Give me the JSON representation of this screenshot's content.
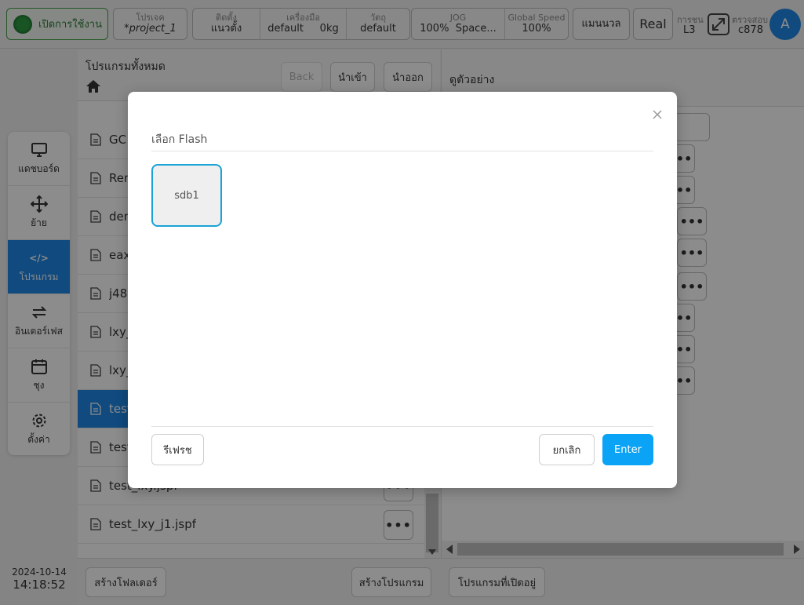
{
  "topbar": {
    "power_label": "เปิดการใช้งาน",
    "project": {
      "label": "โปรเจค",
      "value": "*project_1"
    },
    "install": {
      "label": "ติดตั้ง",
      "value": "แนวตั้ง"
    },
    "tool": {
      "label": "เครื่องมือ",
      "value": "default",
      "payload": "0kg"
    },
    "object": {
      "label": "วัตถุ",
      "value": "default"
    },
    "jog": {
      "label": "JOG",
      "value_pct": "100%",
      "value_space": "Space..."
    },
    "global_speed": {
      "label": "Global Speed",
      "value": "100%"
    },
    "mode_button": "แมนนวล",
    "real_button": "Real",
    "collision": {
      "label": "การชน",
      "value": "L3"
    },
    "check": {
      "label": "ตรวจสอบ",
      "value": "c878"
    },
    "avatar_letter": "A"
  },
  "sidenav": {
    "items": [
      {
        "label": "แดชบอร์ด",
        "icon": "monitor-icon"
      },
      {
        "label": "ย้าย",
        "icon": "move-icon"
      },
      {
        "label": "โปรแกรม",
        "icon": "code-icon",
        "active": true
      },
      {
        "label": "อินเตอร์เฟส",
        "icon": "swap-icon"
      },
      {
        "label": "ชุง",
        "icon": "calendar-icon"
      },
      {
        "label": "ตั้งค่า",
        "icon": "gear-icon"
      }
    ],
    "code_glyph": "</>"
  },
  "clock": {
    "date": "2024-10-14",
    "time": "14:18:52"
  },
  "program_list": {
    "title": "โปรแกรมทั้งหมด",
    "back_label": "Back",
    "import_label": "นำเข้า",
    "export_label": "นำออก",
    "files": [
      {
        "name": "GC"
      },
      {
        "name": "Ren"
      },
      {
        "name": "dem"
      },
      {
        "name": "eax"
      },
      {
        "name": "j48"
      },
      {
        "name": "lxy_"
      },
      {
        "name": "lxy_"
      },
      {
        "name": "test",
        "selected": true
      },
      {
        "name": "test"
      },
      {
        "name": "test_lxy.jspf"
      },
      {
        "name": "test_lxy_j1.jspf"
      }
    ],
    "more_glyph": "•••"
  },
  "preview": {
    "title": "ดูตัวอย่าง"
  },
  "bottombar": {
    "create_folder": "สร้างโฟลเดอร์",
    "create_program": "สร้างโปรแกรม",
    "open_programs": "โปรแกรมที่เปิดอยู่"
  },
  "modal": {
    "title": "เลือก Flash",
    "flash_items": [
      "sdb1"
    ],
    "refresh_label": "รีเฟรช",
    "cancel_label": "ยกเลิก",
    "enter_label": "Enter"
  },
  "colors": {
    "accent": "#1e88e5",
    "enter_button": "#0aa3f5",
    "power_green": "#2e9a43",
    "flash_border": "#1aa3d6"
  }
}
